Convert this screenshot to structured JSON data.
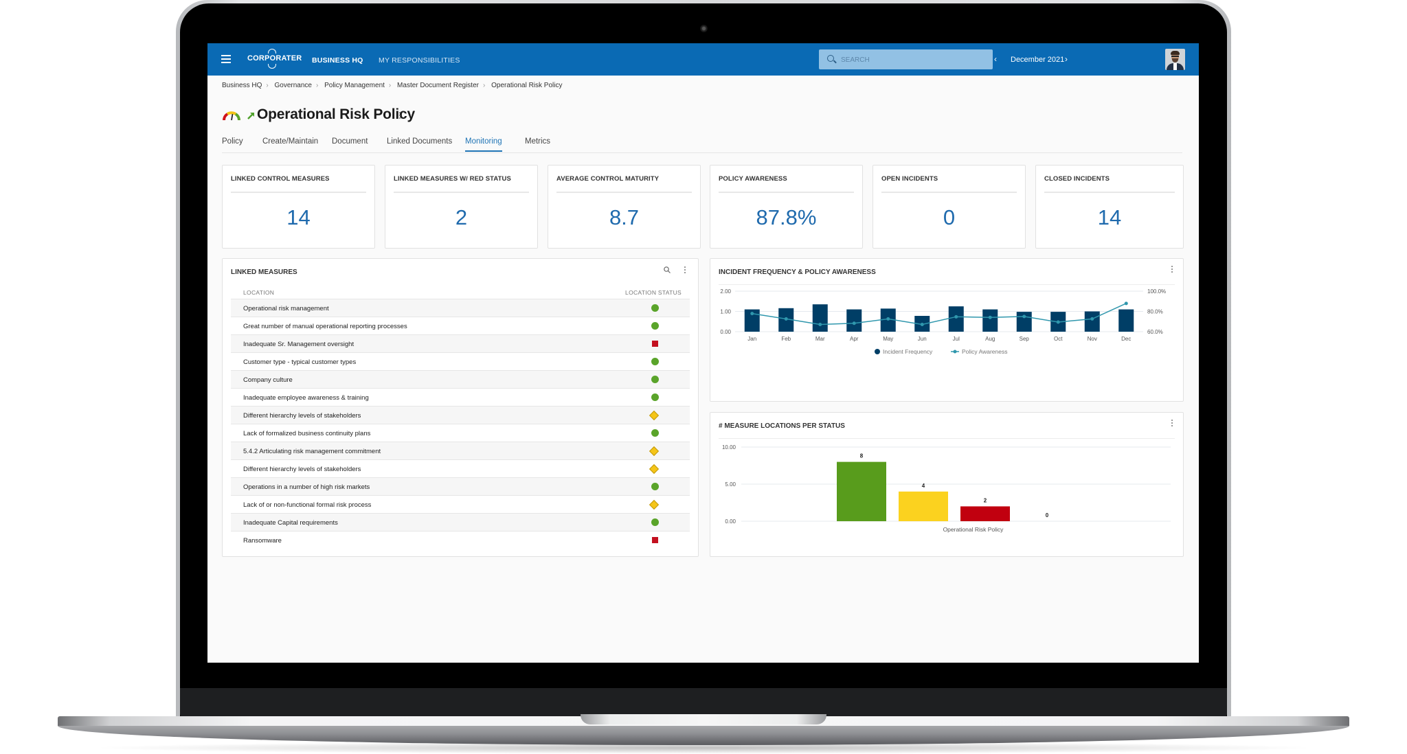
{
  "header": {
    "menu_icon": "hamburger-menu-icon",
    "logo": "CORPORATER",
    "nav": [
      "BUSINESS HQ",
      "MY RESPONSIBILITIES"
    ],
    "search_placeholder": "SEARCH",
    "period": "December 2021",
    "prev_icon": "‹",
    "next_icon": "›"
  },
  "breadcrumb": [
    "Business HQ",
    "Governance",
    "Policy Management",
    "Master Document Register",
    "Operational Risk Policy"
  ],
  "breadcrumb_sep": "›",
  "page": {
    "title": "Operational Risk Policy",
    "tabs": [
      {
        "label": "Policy",
        "active": false
      },
      {
        "label": "Create/Maintain",
        "active": false
      },
      {
        "label": "Document",
        "active": false
      },
      {
        "label": "Linked Documents",
        "active": false
      },
      {
        "label": "Monitoring",
        "active": true
      },
      {
        "label": "Metrics",
        "active": false
      }
    ]
  },
  "kpis": [
    {
      "label": "LINKED CONTROL MEASURES",
      "value": "14"
    },
    {
      "label": "LINKED MEASURES W/ RED STATUS",
      "value": "2"
    },
    {
      "label": "AVERAGE CONTROL MATURITY",
      "value": "8.7"
    },
    {
      "label": "POLICY AWARENESS",
      "value": "87.8%"
    },
    {
      "label": "OPEN INCIDENTS",
      "value": "0"
    },
    {
      "label": "CLOSED INCIDENTS",
      "value": "14"
    }
  ],
  "linked_measures": {
    "title": "LINKED MEASURES",
    "columns": [
      "LOCATION",
      "LOCATION STATUS"
    ],
    "rows": [
      {
        "location": "Operational risk management",
        "status": "green"
      },
      {
        "location": "Great number of manual operational reporting processes",
        "status": "green"
      },
      {
        "location": "Inadequate Sr. Management oversight",
        "status": "red"
      },
      {
        "location": "Customer type - typical customer types",
        "status": "green"
      },
      {
        "location": "Company culture",
        "status": "green"
      },
      {
        "location": "Inadequate employee awareness & training",
        "status": "green"
      },
      {
        "location": "Different hierarchy levels of stakeholders",
        "status": "yellow"
      },
      {
        "location": "Lack of formalized business continuity plans",
        "status": "green"
      },
      {
        "location": "5.4.2 Articulating risk management commitment",
        "status": "yellow"
      },
      {
        "location": "Different hierarchy levels of stakeholders",
        "status": "yellow"
      },
      {
        "location": "Operations in a number of high risk markets",
        "status": "green"
      },
      {
        "location": "Lack of or non-functional formal risk process",
        "status": "yellow"
      },
      {
        "location": "Inadequate Capital requirements",
        "status": "green"
      },
      {
        "location": "Ransomware",
        "status": "red"
      }
    ]
  },
  "colors": {
    "brand": "#0a6ab4",
    "kpi_value": "#1f6aad",
    "bar_navy": "#003e66",
    "line_teal": "#2f97ad",
    "status_green": "#5aa42a",
    "status_yellow": "#f5c518",
    "status_red": "#c3101f"
  },
  "chart_data": [
    {
      "type": "bar",
      "title": "INCIDENT FREQUENCY & POLICY AWARENESS",
      "categories": [
        "Jan",
        "Feb",
        "Mar",
        "Apr",
        "May",
        "Jun",
        "Jul",
        "Aug",
        "Sep",
        "Oct",
        "Nov",
        "Dec"
      ],
      "series": [
        {
          "name": "Incident Frequency",
          "type": "bar",
          "axis": "left",
          "values": [
            1.1,
            1.16,
            1.35,
            1.1,
            1.14,
            0.78,
            1.25,
            1.1,
            0.98,
            0.98,
            1.0,
            1.1
          ]
        },
        {
          "name": "Policy Awareness",
          "type": "line",
          "axis": "right",
          "values": [
            77.9,
            72.6,
            67.1,
            68.3,
            72.6,
            67.1,
            74.7,
            74.1,
            75.0,
            69.5,
            72.6,
            87.9
          ]
        }
      ],
      "ylim": [
        0,
        2
      ],
      "yticks": [
        "0.00",
        "1.00",
        "2.00"
      ],
      "y2lim": [
        60,
        100
      ],
      "y2ticks": [
        "60.0%",
        "80.0%",
        "100.0%"
      ],
      "grid": true,
      "legend": "bottom-center"
    },
    {
      "type": "bar",
      "title": "# MEASURE LOCATIONS PER STATUS",
      "categories": [
        "Operational Risk Policy"
      ],
      "series": [
        {
          "name": "Green",
          "color": "#589c1c",
          "values": [
            8
          ]
        },
        {
          "name": "Yellow",
          "color": "#fbd21f",
          "values": [
            4
          ]
        },
        {
          "name": "Red",
          "color": "#c1000f",
          "values": [
            2
          ]
        },
        {
          "name": "None",
          "color": "#999999",
          "values": [
            0
          ]
        }
      ],
      "ylim": [
        0,
        10
      ],
      "yticks": [
        "0.00",
        "5.00",
        "10.00"
      ],
      "grid": true
    }
  ]
}
